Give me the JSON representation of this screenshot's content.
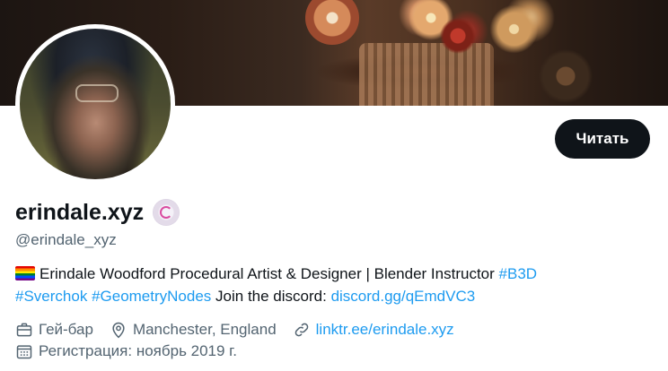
{
  "profile": {
    "display_name": "erindale.xyz",
    "handle": "@erindale_xyz",
    "follow_button": "Читать",
    "bio": {
      "text": "Erindale Woodford Procedural Artist & Designer | Blender Instructor",
      "hashtag1": "#B3D",
      "hashtag2": "#Sverchok",
      "hashtag3": "#GeometryNodes",
      "join_text": "Join the discord:",
      "discord_link": "discord.gg/qEmdVC3"
    },
    "meta": {
      "category": "Гей-бар",
      "location": "Manchester, England",
      "website": "linktr.ee/erindale.xyz",
      "joined": "Регистрация: ноябрь 2019 г."
    }
  },
  "icons": {
    "category": "briefcase-icon",
    "location": "location-pin-icon",
    "website": "link-icon",
    "joined": "calendar-icon",
    "flag": "rainbow-flag-icon",
    "badge": "spiral-badge-icon"
  },
  "colors": {
    "link": "#1d9bf0",
    "secondary_text": "#536471",
    "primary_text": "#0f1419",
    "button_bg": "#0f1419"
  }
}
